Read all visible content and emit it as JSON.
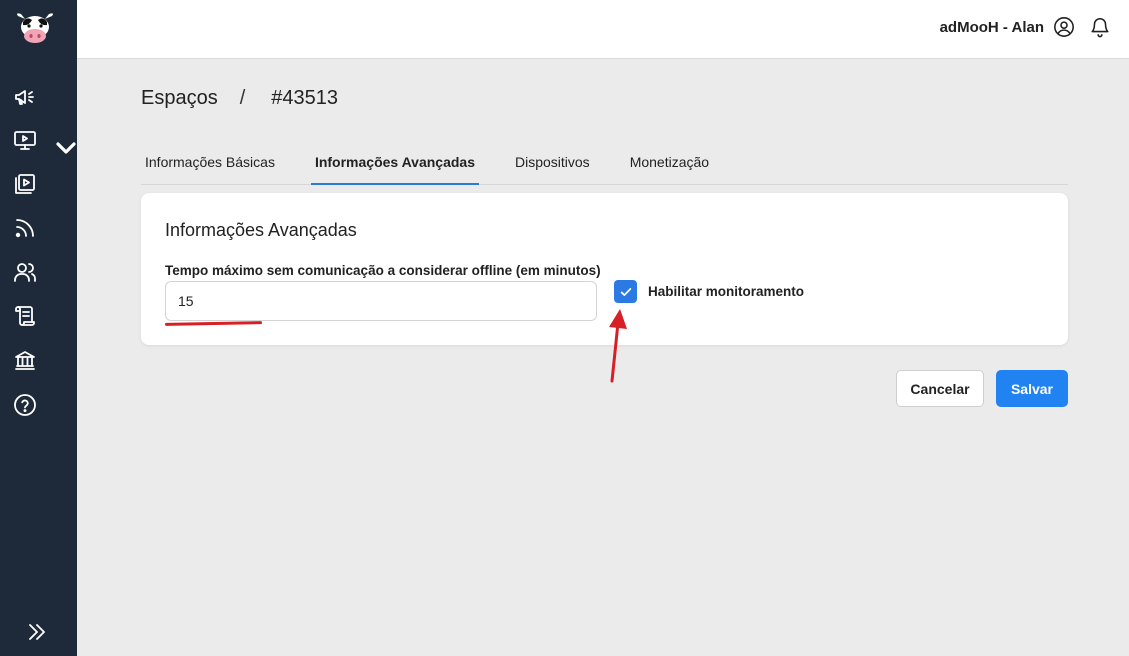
{
  "header": {
    "user_name": "adMooH - Alan",
    "user_icon": "user-circle-icon",
    "notifications_icon": "bell-icon"
  },
  "sidebar": {
    "logo": "cow-logo",
    "items": [
      {
        "icon": "megaphone-icon"
      },
      {
        "icon": "monitor-play-icon"
      },
      {
        "icon": "playlist-icon"
      },
      {
        "icon": "rss-icon"
      },
      {
        "icon": "users-icon"
      },
      {
        "icon": "scroll-icon"
      },
      {
        "icon": "bank-icon"
      },
      {
        "icon": "help-icon"
      }
    ],
    "collapse_icon": "double-chevron-right-icon"
  },
  "breadcrumb": {
    "root": "Espaços",
    "separator": "/",
    "current": "#43513"
  },
  "tabs": [
    {
      "label": "Informações Básicas",
      "active": false
    },
    {
      "label": "Informações Avançadas",
      "active": true
    },
    {
      "label": "Dispositivos",
      "active": false
    },
    {
      "label": "Monetização",
      "active": false
    }
  ],
  "card": {
    "title": "Informações Avançadas",
    "offline_field": {
      "label": "Tempo máximo sem comunicação a considerar offline (em minutos)",
      "value": "15"
    },
    "monitoring": {
      "label": "Habilitar monitoramento",
      "checked": true
    }
  },
  "actions": {
    "cancel_label": "Cancelar",
    "save_label": "Salvar"
  },
  "colors": {
    "sidebar_bg": "#1e2a3a",
    "accent": "#2183f2",
    "annotation": "#d71f26"
  }
}
